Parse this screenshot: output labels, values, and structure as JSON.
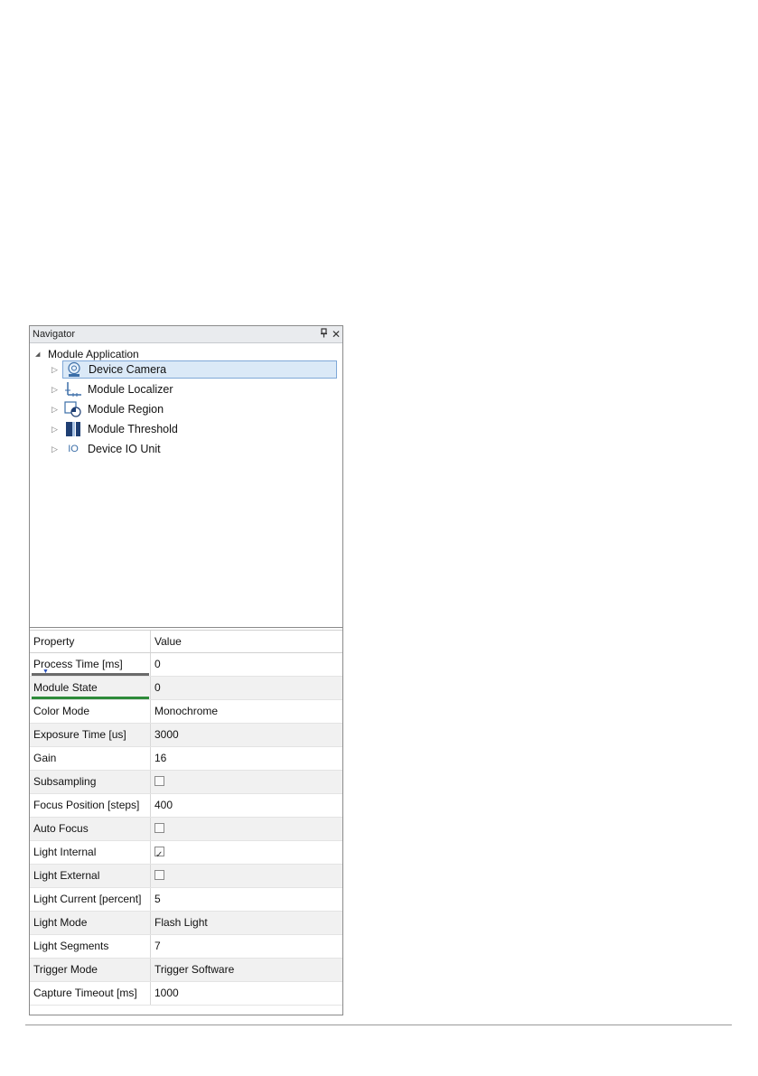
{
  "navigator": {
    "title": "Navigator",
    "pin_icon": "pin-icon",
    "close_icon": "close-icon",
    "root_label": "Module Application",
    "items": [
      {
        "label": "Device Camera",
        "icon": "camera-icon",
        "selected": true
      },
      {
        "label": "Module Localizer",
        "icon": "localizer-icon"
      },
      {
        "label": "Module Region",
        "icon": "region-icon"
      },
      {
        "label": "Module Threshold",
        "icon": "threshold-icon"
      },
      {
        "label": "Device IO Unit",
        "icon": "io-icon",
        "icon_text": "IO"
      }
    ]
  },
  "properties": {
    "header": {
      "property": "Property",
      "value": "Value"
    },
    "rows": [
      {
        "name": "Process Time [ms]",
        "value": "0"
      },
      {
        "name": "Module State",
        "value": "0"
      },
      {
        "name": "Color Mode",
        "value": "Monochrome"
      },
      {
        "name": "Exposure Time [us]",
        "value": "3000"
      },
      {
        "name": "Gain",
        "value": "16"
      },
      {
        "name": "Subsampling",
        "checked": false
      },
      {
        "name": "Focus Position [steps]",
        "value": "400"
      },
      {
        "name": "Auto Focus",
        "checked": false
      },
      {
        "name": "Light Internal",
        "checked": true
      },
      {
        "name": "Light External",
        "checked": false
      },
      {
        "name": "Light Current [percent]",
        "value": "5"
      },
      {
        "name": "Light Mode",
        "value": "Flash Light"
      },
      {
        "name": "Light Segments",
        "value": "7"
      },
      {
        "name": "Trigger Mode",
        "value": "Trigger Software"
      },
      {
        "name": "Capture Timeout [ms]",
        "value": "1000"
      }
    ]
  },
  "colors": {
    "selection": "#dbe9f7",
    "selection_border": "#7fa8d8",
    "state_bar": "#2e8b3a"
  }
}
